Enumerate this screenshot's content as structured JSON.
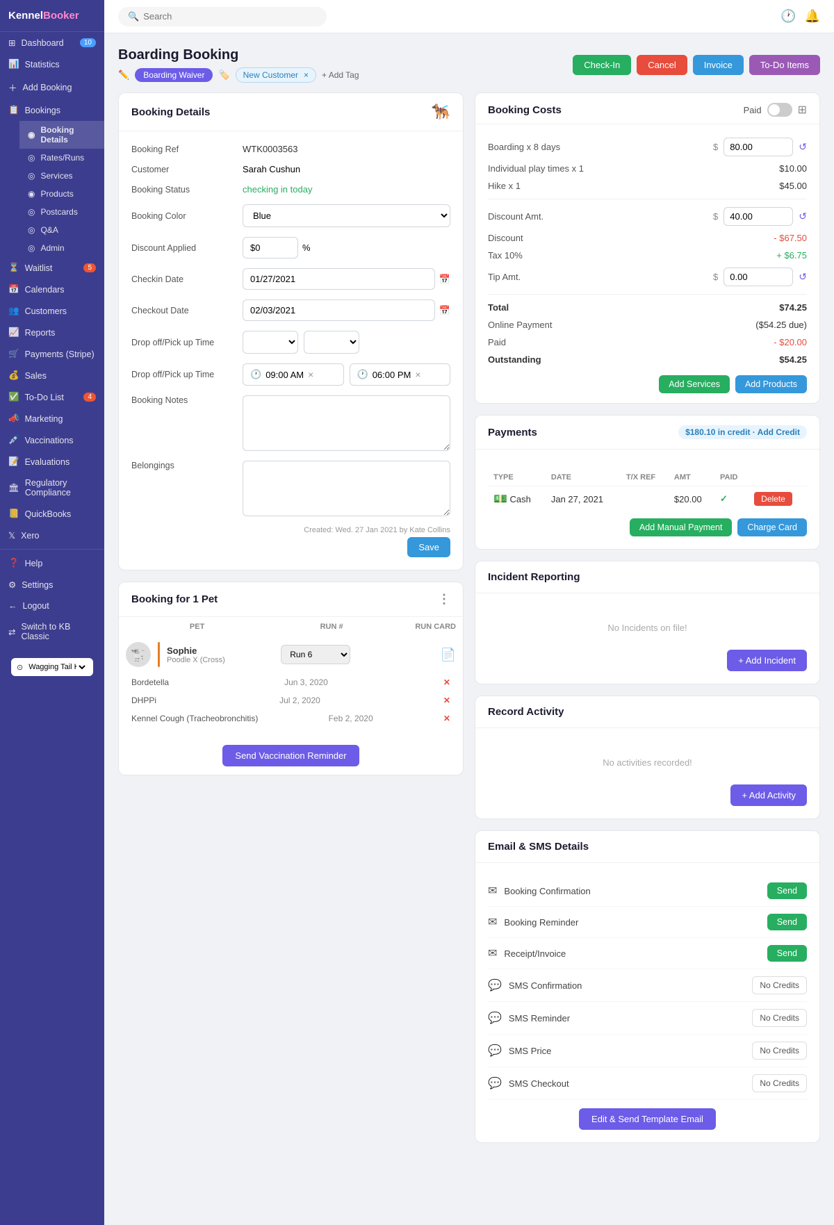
{
  "app": {
    "name": "KennelBooker",
    "logo_highlight": "Booker"
  },
  "sidebar": {
    "items": [
      {
        "id": "dashboard",
        "label": "Dashboard",
        "badge": "10",
        "badge_color": "blue"
      },
      {
        "id": "statistics",
        "label": "Statistics"
      },
      {
        "id": "add-booking",
        "label": "Add Booking"
      },
      {
        "id": "bookings",
        "label": "Bookings",
        "expanded": true
      },
      {
        "id": "booking-details",
        "label": "Booking Details",
        "active": true,
        "sub": true
      },
      {
        "id": "rates-runs",
        "label": "Rates/Runs",
        "sub": true
      },
      {
        "id": "services",
        "label": "Services",
        "sub": true
      },
      {
        "id": "products",
        "label": "Products",
        "sub": true
      },
      {
        "id": "postcards",
        "label": "Postcards",
        "sub": true
      },
      {
        "id": "qa",
        "label": "Q&A",
        "sub": true
      },
      {
        "id": "admin",
        "label": "Admin",
        "sub": true
      },
      {
        "id": "waitlist",
        "label": "Waitlist",
        "badge": "5"
      },
      {
        "id": "calendars",
        "label": "Calendars"
      },
      {
        "id": "customers",
        "label": "Customers"
      },
      {
        "id": "reports",
        "label": "Reports"
      },
      {
        "id": "payments",
        "label": "Payments (Stripe)"
      },
      {
        "id": "sales",
        "label": "Sales"
      },
      {
        "id": "todo",
        "label": "To-Do List",
        "badge": "4"
      },
      {
        "id": "marketing",
        "label": "Marketing"
      },
      {
        "id": "vaccinations",
        "label": "Vaccinations"
      },
      {
        "id": "evaluations",
        "label": "Evaluations"
      },
      {
        "id": "regulatory",
        "label": "Regulatory Compliance"
      },
      {
        "id": "quickbooks",
        "label": "QuickBooks"
      },
      {
        "id": "xero",
        "label": "Xero"
      },
      {
        "id": "help",
        "label": "Help"
      },
      {
        "id": "settings",
        "label": "Settings"
      },
      {
        "id": "logout",
        "label": "Logout"
      },
      {
        "id": "kb-classic",
        "label": "Switch to KB Classic"
      }
    ],
    "kennel": "Wagging Tail Kennel"
  },
  "topbar": {
    "search_placeholder": "Search"
  },
  "page": {
    "title": "Boarding Booking",
    "tags": {
      "boarding_waiver": "Boarding Waiver",
      "new_customer": "New Customer",
      "new_customer_close": "×",
      "add_tag": "+ Add Tag"
    },
    "actions": {
      "check_in": "Check-In",
      "cancel": "Cancel",
      "invoice": "Invoice",
      "todo_items": "To-Do Items"
    }
  },
  "booking_details": {
    "title": "Booking Details",
    "booking_ref_label": "Booking Ref",
    "booking_ref_value": "WTK0003563",
    "customer_label": "Customer",
    "customer_value": "Sarah Cushun",
    "booking_status_label": "Booking Status",
    "booking_status_value": "checking in today",
    "booking_color_label": "Booking Color",
    "booking_color_value": "Blue",
    "discount_applied_label": "Discount Applied",
    "discount_applied_value": "$0",
    "discount_percent": "%",
    "checkin_date_label": "Checkin Date",
    "checkin_date_value": "01/27/2021",
    "checkout_date_label": "Checkout Date",
    "checkout_date_value": "02/03/2021",
    "dropoff_time_label1": "Drop off/Pick up Time",
    "dropoff_time_label2": "Drop off/Pick up Time",
    "time_from": "09:00 AM",
    "time_to": "06:00 PM",
    "booking_notes_label": "Booking Notes",
    "booking_notes_value": "",
    "belongings_label": "Belongings",
    "belongings_value": "",
    "created_info": "Created: Wed. 27 Jan 2021 by Kate Collins",
    "save_button": "Save"
  },
  "booking_costs": {
    "title": "Booking Costs",
    "paid_label": "Paid",
    "boarding_label": "Boarding x 8 days",
    "boarding_value": "$ 80.00",
    "individual_play_label": "Individual play times x 1",
    "individual_play_value": "$10.00",
    "hike_label": "Hike x 1",
    "hike_value": "$45.00",
    "discount_amt_label": "Discount Amt.",
    "discount_amt_value": "$ 40.00",
    "discount_label": "Discount",
    "discount_value": "- $67.50",
    "tax_label": "Tax 10%",
    "tax_value": "+ $6.75",
    "tip_amt_label": "Tip Amt.",
    "tip_amt_value": "$ 0.00",
    "total_label": "Total",
    "total_value": "$74.25",
    "online_payment_label": "Online Payment",
    "online_payment_value": "($54.25 due)",
    "paid_amount_label": "Paid",
    "paid_amount_value": "- $20.00",
    "outstanding_label": "Outstanding",
    "outstanding_value": "$54.25",
    "add_services_btn": "Add Services",
    "add_products_btn": "Add Products"
  },
  "payments": {
    "title": "Payments",
    "credit_badge": "$180.10 in credit · Add Credit",
    "columns": [
      "TYPE",
      "DATE",
      "T/X REF",
      "AMT",
      "PAID"
    ],
    "rows": [
      {
        "type": "Cash",
        "date": "Jan 27, 2021",
        "txref": "",
        "amt": "$20.00",
        "paid": true
      }
    ],
    "add_manual_btn": "Add Manual Payment",
    "charge_card_btn": "Charge Card"
  },
  "incident_reporting": {
    "title": "Incident Reporting",
    "empty_text": "No Incidents on file!",
    "add_btn": "+ Add Incident"
  },
  "record_activity": {
    "title": "Record Activity",
    "empty_text": "No activities recorded!",
    "add_btn": "+ Add Activity"
  },
  "booking_pet": {
    "title": "Booking for 1 Pet",
    "columns": [
      "PET",
      "RUN #",
      "RUN CARD"
    ],
    "pet_name": "Sophie",
    "pet_breed": "Poodle X (Cross)",
    "run": "Run 6",
    "vaccinations": [
      {
        "name": "Bordetella",
        "date": "Jun 3, 2020",
        "status": "expired"
      },
      {
        "name": "DHPPi",
        "date": "Jul 2, 2020",
        "status": "expired"
      },
      {
        "name": "Kennel Cough (Tracheobronchitis)",
        "date": "Feb 2, 2020",
        "status": "expired"
      }
    ],
    "send_vacc_btn": "Send Vaccination Reminder"
  },
  "email_sms": {
    "title": "Email & SMS Details",
    "items": [
      {
        "type": "email",
        "label": "Booking Confirmation",
        "action": "Send"
      },
      {
        "type": "email",
        "label": "Booking Reminder",
        "action": "Send"
      },
      {
        "type": "email",
        "label": "Receipt/Invoice",
        "action": "Send"
      },
      {
        "type": "sms",
        "label": "SMS Confirmation",
        "action": "No Credits"
      },
      {
        "type": "sms",
        "label": "SMS Reminder",
        "action": "No Credits"
      },
      {
        "type": "sms",
        "label": "SMS Price",
        "action": "No Credits"
      },
      {
        "type": "sms",
        "label": "SMS Checkout",
        "action": "No Credits"
      }
    ],
    "edit_send_btn": "Edit & Send Template Email"
  },
  "colors": {
    "sidebar_bg": "#3d3d8f",
    "check_in_btn": "#27ae60",
    "cancel_btn": "#e74c3c",
    "invoice_btn": "#3498db",
    "todo_btn": "#9b59b6",
    "purple_btn": "#6c5ce7",
    "green_btn": "#27ae60"
  }
}
